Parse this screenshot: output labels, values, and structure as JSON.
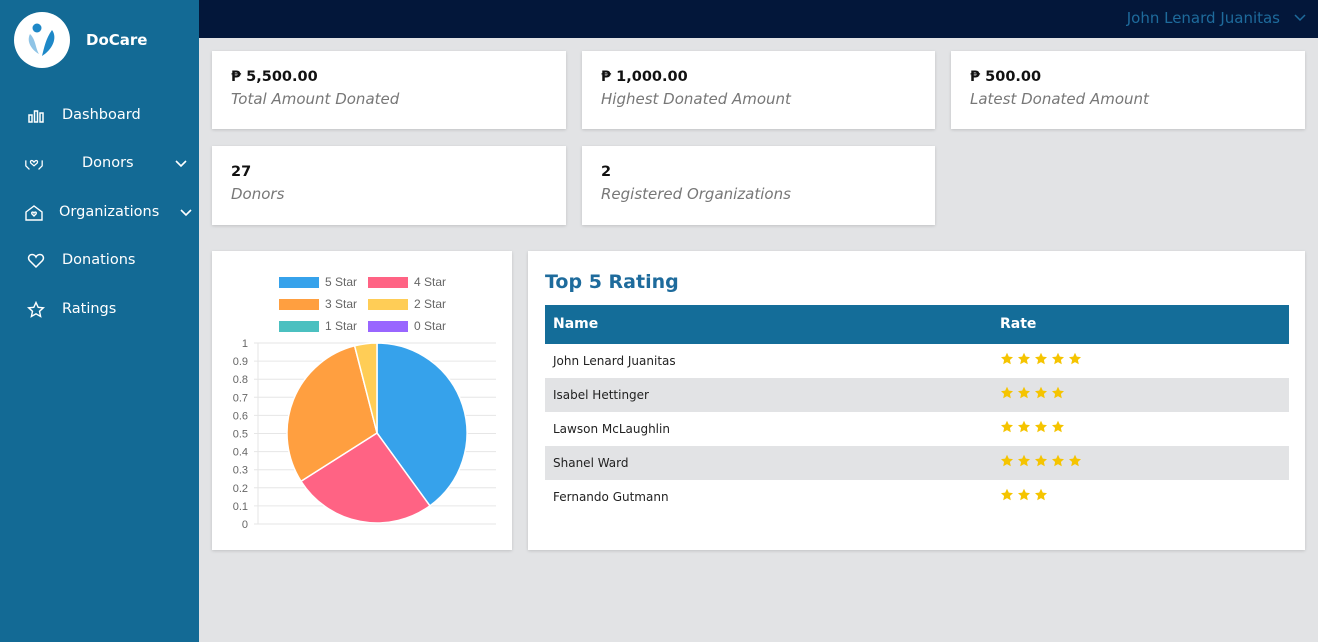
{
  "app": {
    "name": "DoCare"
  },
  "header": {
    "user_name": "John Lenard Juanitas"
  },
  "sidebar": {
    "items": [
      {
        "label": "Dashboard",
        "icon": "bar-chart-icon"
      },
      {
        "label": "Donors",
        "icon": "hands-heart-icon",
        "has_chevron": true
      },
      {
        "label": "Organizations",
        "icon": "house-heart-icon",
        "has_chevron": true
      },
      {
        "label": "Donations",
        "icon": "heart-icon"
      },
      {
        "label": "Ratings",
        "icon": "star-icon"
      }
    ]
  },
  "stats": [
    {
      "value": "₱ 5,500.00",
      "label": "Total Amount Donated"
    },
    {
      "value": "₱ 1,000.00",
      "label": "Highest Donated Amount"
    },
    {
      "value": "₱ 500.00",
      "label": "Latest Donated Amount"
    },
    {
      "value": "27",
      "label": "Donors"
    },
    {
      "value": "2",
      "label": "Registered Organizations"
    }
  ],
  "chart_data": {
    "type": "pie",
    "categories": [
      "5 Star",
      "4 Star",
      "3 Star",
      "2 Star",
      "1 Star",
      "0 Star"
    ],
    "values": [
      2,
      1.3,
      1.5,
      0.2,
      0,
      0
    ],
    "colors": [
      "#36a2eb",
      "#ff6384",
      "#ff9f40",
      "#ffcd56",
      "#4bc0c0",
      "#9966ff"
    ],
    "y_ticks": [
      "1",
      "0.9",
      "0.8",
      "0.7",
      "0.6",
      "0.5",
      "0.4",
      "0.3",
      "0.2",
      "0.1",
      "0"
    ],
    "legend_position": "top",
    "grid": true
  },
  "ratings": {
    "title": "Top 5 Rating",
    "columns": [
      "Name",
      "Rate"
    ],
    "rows": [
      {
        "name": "John Lenard Juanitas",
        "stars": 5
      },
      {
        "name": "Isabel Hettinger",
        "stars": 4
      },
      {
        "name": "Lawson McLaughlin",
        "stars": 4
      },
      {
        "name": "Shanel Ward",
        "stars": 5
      },
      {
        "name": "Fernando Gutmann",
        "stars": 3
      }
    ],
    "star_color": "#f5c400",
    "header_color": "#146d99"
  }
}
